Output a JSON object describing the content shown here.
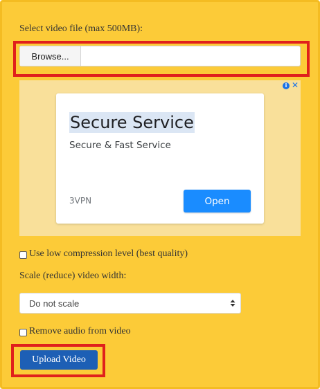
{
  "form": {
    "file_label": "Select video file (max 500MB):",
    "browse_label": "Browse...",
    "file_name": "",
    "compression_label": "Use low compression level (best quality)",
    "compression_checked": false,
    "scale_label": "Scale (reduce) video width:",
    "scale_selected": "Do not scale",
    "remove_audio_label": "Remove audio from video",
    "remove_audio_checked": false,
    "upload_label": "Upload Video"
  },
  "ad": {
    "title": "Secure Service",
    "subtitle": "Secure & Fast Service",
    "brand": "3VPN",
    "cta": "Open",
    "info_icon": "info-icon",
    "close_icon": "close-icon"
  },
  "colors": {
    "panel_bg": "#fccb38",
    "highlight": "#e0201c",
    "upload_button": "#1d5fb5",
    "ad_cta": "#1a8cff"
  }
}
